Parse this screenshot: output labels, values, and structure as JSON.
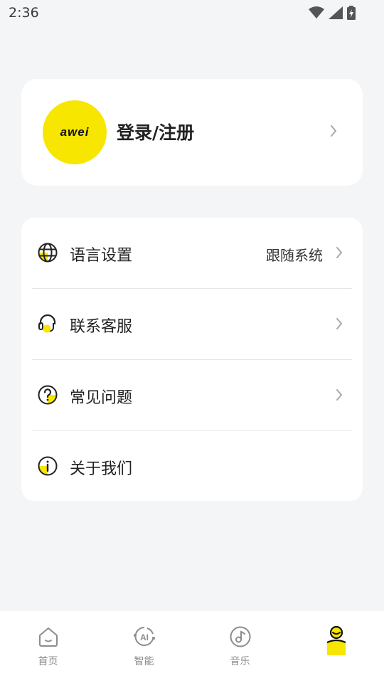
{
  "status_bar": {
    "time": "2:36"
  },
  "profile": {
    "logo_text": "awei",
    "login_label": "登录/注册"
  },
  "menu": {
    "items": [
      {
        "label": "语言设置",
        "value": "跟随系统"
      },
      {
        "label": "联系客服"
      },
      {
        "label": "常见问题"
      },
      {
        "label": "关于我们"
      }
    ]
  },
  "tabs": [
    {
      "label": "首页",
      "icon": "home-icon"
    },
    {
      "label": "智能",
      "icon": "ai-icon"
    },
    {
      "label": "音乐",
      "icon": "music-icon"
    },
    {
      "label": "",
      "icon": "profile-icon",
      "active": true
    }
  ],
  "colors": {
    "accent": "#f7e600",
    "background": "#f4f5f7",
    "card": "#ffffff"
  }
}
